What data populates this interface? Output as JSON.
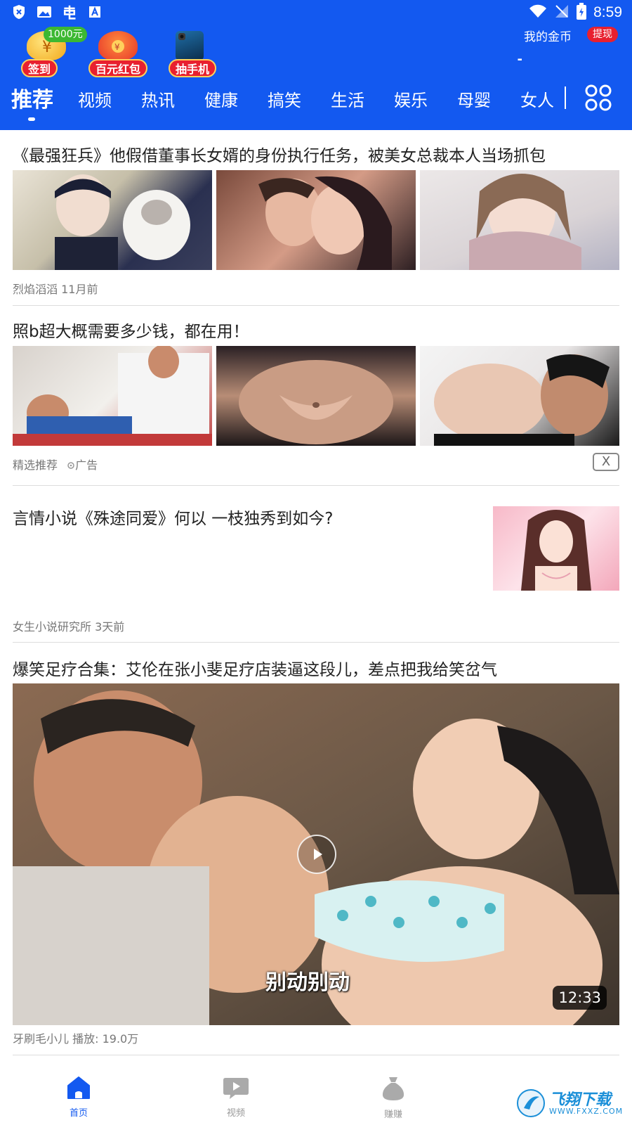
{
  "status_bar": {
    "time": "8:59"
  },
  "promos": [
    {
      "label": "签到",
      "badge": "1000元"
    },
    {
      "label": "百元红包"
    },
    {
      "label": "抽手机"
    }
  ],
  "coins": {
    "label": "我的金币",
    "value": "-",
    "withdraw_label": "提现"
  },
  "tabs": [
    "推荐",
    "视频",
    "热讯",
    "健康",
    "搞笑",
    "生活",
    "娱乐",
    "母婴",
    "女人"
  ],
  "feed": [
    {
      "title": "《最强狂兵》他假借董事长女婿的身份执行任务，被美女总裁本人当场抓包",
      "source": "烈焰滔滔",
      "time": "11月前"
    },
    {
      "title": "照b超大概需要多少钱，都在用！",
      "source": "精选推荐",
      "ad_label": "广告",
      "close_label": "X"
    },
    {
      "title": "言情小说《殊途同爱》何以 一枝独秀到如今?",
      "source": "女生小说研究所",
      "time": "3天前"
    },
    {
      "title": "爆笑足疗合集：艾伦在张小斐足疗店装逼这段儿，差点把我给笑岔气",
      "subtitle": "别动别动",
      "duration": "12:33",
      "source": "牙刷毛小儿",
      "plays": "播放: 19.0万"
    }
  ],
  "bottom_nav": [
    {
      "label": "首页",
      "icon": "home-icon"
    },
    {
      "label": "视频",
      "icon": "video-icon"
    },
    {
      "label": "赚赚",
      "icon": "money-bag-icon"
    }
  ],
  "watermark": {
    "text": "飞翔下载",
    "url": "WWW.FXXZ.COM"
  },
  "colors": {
    "brand": "#1359f0",
    "red": "#e8202f",
    "green": "#3cb832"
  }
}
